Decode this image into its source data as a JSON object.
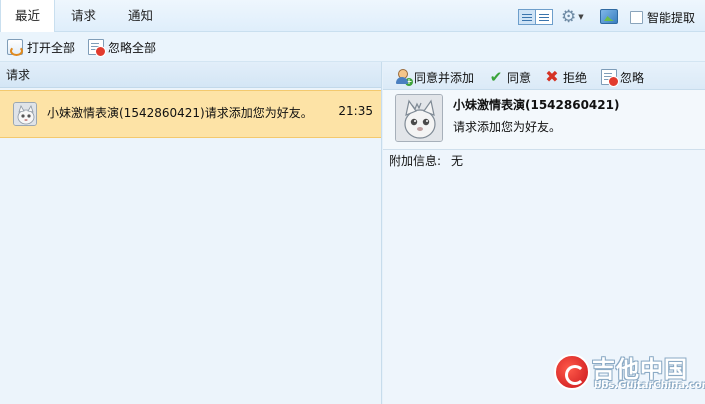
{
  "tabs": [
    {
      "label": "最近",
      "active": true
    },
    {
      "label": "请求",
      "active": false
    },
    {
      "label": "通知",
      "active": false
    }
  ],
  "header": {
    "smart_extract_label": "智能提取",
    "smart_extract_checked": false,
    "view_icon": "list-view-icon",
    "settings_icon": "gear-icon",
    "image_icon": "image-icon"
  },
  "toolbar": {
    "open_all": "打开全部",
    "ignore_all": "忽略全部"
  },
  "left_panel": {
    "header": "请求",
    "items": [
      {
        "text": "小妹激情表演(1542860421)请求添加您为好友。",
        "time": "21:35",
        "selected": true
      }
    ]
  },
  "right_panel": {
    "actions": {
      "agree_add": "同意并添加",
      "agree": "同意",
      "reject": "拒绝",
      "ignore": "忽略"
    },
    "profile": {
      "name": "小妹激情表演(1542860421)",
      "message": "请求添加您为好友。"
    },
    "extra": {
      "label": "附加信息:",
      "value": "无"
    }
  },
  "watermark": {
    "title": "吉他中国",
    "url": "bbs.GuitarChina.com"
  },
  "colors": {
    "selected_row": "#fde3a6",
    "panel_bg": "#ecf4fb",
    "accent": "#3a74ad"
  }
}
